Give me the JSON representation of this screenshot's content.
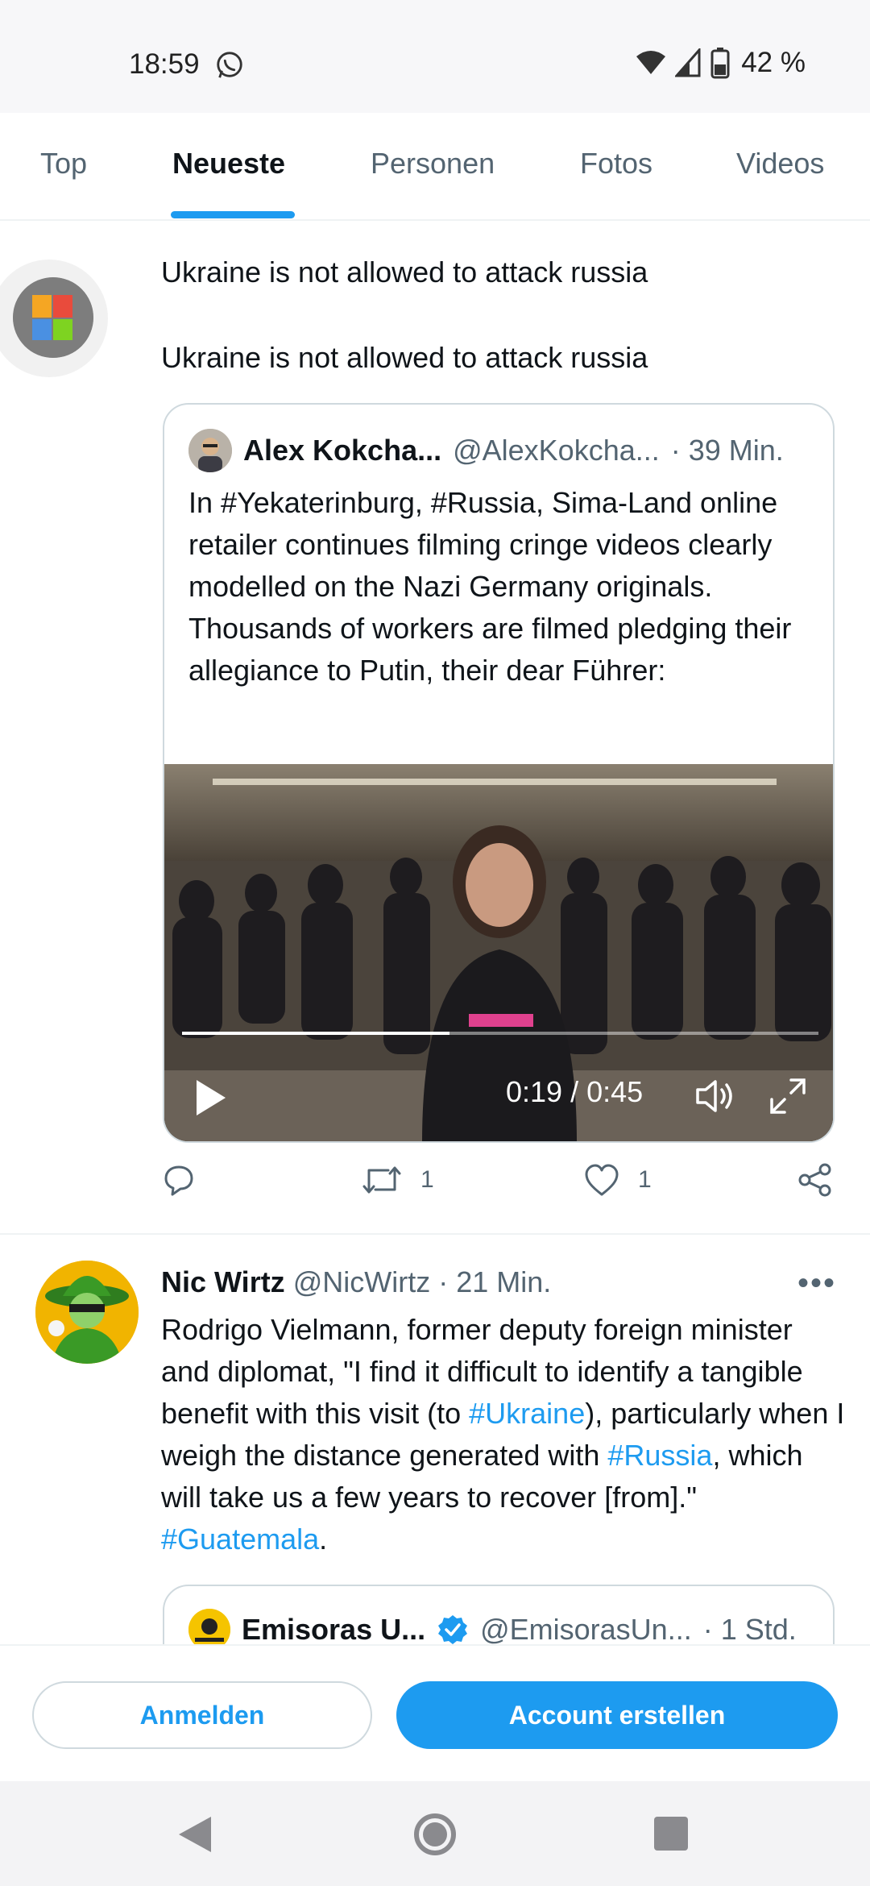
{
  "status_bar": {
    "time": "18:59",
    "battery": "42 %",
    "icons": [
      "whatsapp-icon",
      "wifi-icon",
      "signal-icon",
      "battery-icon"
    ]
  },
  "tabs": [
    {
      "label": "Top",
      "active": false
    },
    {
      "label": "Neueste",
      "active": true
    },
    {
      "label": "Personen",
      "active": false
    },
    {
      "label": "Fotos",
      "active": false
    },
    {
      "label": "Videos",
      "active": false
    }
  ],
  "tweet1": {
    "text_line1": "Ukraine is not allowed to attack russia",
    "text_line2": "Ukraine is not allowed to attack russia",
    "quote": {
      "name": "Alex Kokcha...",
      "handle": "@AlexKokcha...",
      "time": "· 39 Min.",
      "body": "In #Yekaterinburg, #Russia, Sima-Land online retailer continues filming cringe videos clearly modelled on the Nazi Germany originals. Thousands of workers are filmed pledging their allegiance to Putin, their dear Führer:",
      "video": {
        "time": "0:19 / 0:45",
        "progress": 0.42
      }
    },
    "actions": {
      "reply_count": "",
      "retweet_count": "1",
      "like_count": "1"
    }
  },
  "tweet2": {
    "name": "Nic Wirtz",
    "handle": "@NicWirtz",
    "time": "· 21 Min.",
    "more": "•••",
    "body_parts": {
      "p1": "Rodrigo Vielmann, former deputy foreign minister and diplomat, \"I find it difficult to identify a tangible benefit with this visit (to ",
      "tag1": "#Ukraine",
      "p2": "), particularly when I weigh the distance generated with ",
      "tag2": "#Russia",
      "p3": ", which will take us a few years to recover [from].\" ",
      "tag3": "#Guatemala",
      "p4": "."
    },
    "quote": {
      "name": "Emisoras U...",
      "handle": "@EmisorasUn...",
      "time": "· 1 Std."
    }
  },
  "bottom_bar": {
    "login_label": "Anmelden",
    "create_label": "Account erstellen"
  },
  "colors": {
    "accent": "#1d9bf0",
    "text": "#0f1419",
    "muted": "#536471"
  }
}
